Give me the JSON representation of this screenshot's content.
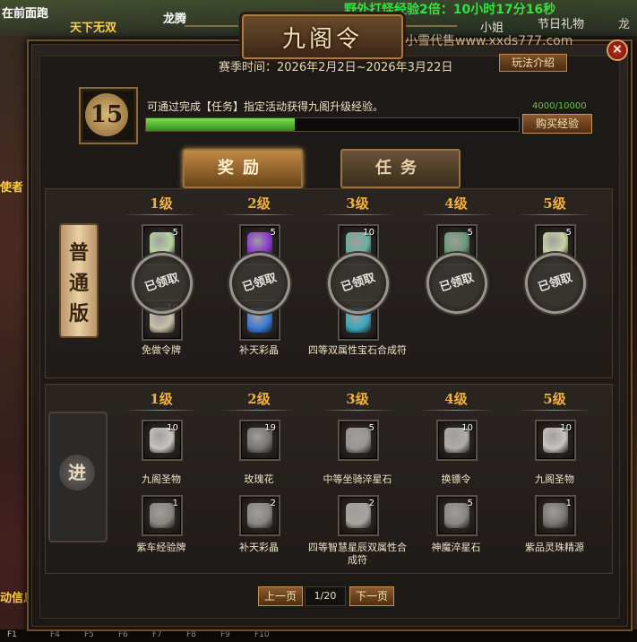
{
  "hud": {
    "left_top": "在前面跑",
    "left_tag": "天下无双",
    "left_name": "龙腾",
    "event_timer": "野外打怪经验2倍：10小时17分16秒",
    "npc_name": "小姐",
    "festival": "节日礼物",
    "right_name": "龙",
    "left_mid": "使者",
    "left_bottom": "动信息",
    "keys": [
      "F1",
      "F4",
      "F5",
      "F6",
      "F7",
      "F8",
      "F9",
      "F10"
    ]
  },
  "panel": {
    "title": "九阁令",
    "watermark": "小雪代售www.xxds777.com",
    "close_label": "×",
    "season_label": "赛季时间：2026年2月2日~2026年3月22日",
    "rules_button": "玩法介绍",
    "current_level": "15",
    "hint": "可通过完成【任务】指定活动获得九阁升级经验。",
    "exp_text": "4000/10000",
    "exp_progress": 0.4,
    "buy_button": "购买经验",
    "tabs": [
      {
        "label": "奖励",
        "active": true
      },
      {
        "label": "任务",
        "active": false
      }
    ]
  },
  "normal": {
    "badge": "普通版",
    "claimed_label": "已领取",
    "levels": [
      {
        "level": "1级",
        "top_count": "5",
        "top_color": "#b8d4a0",
        "bottom_count": "10",
        "bottom_color": "#c8c0a8",
        "name": "免做令牌",
        "claimed": true
      },
      {
        "level": "2级",
        "top_count": "5",
        "top_color": "#8a3ad0",
        "bottom_count": "",
        "bottom_color": "#3a7ad8",
        "name": "补天彩晶",
        "claimed": true
      },
      {
        "level": "3级",
        "top_count": "10",
        "top_color": "#6ab0a0",
        "bottom_count": "",
        "bottom_color": "#3aa8c0",
        "name": "四等双属性宝石合成符",
        "claimed": true
      },
      {
        "level": "4级",
        "top_count": "5",
        "top_color": "#6a9a7a",
        "bottom_count": "",
        "bottom_color": "",
        "name": "",
        "claimed": true
      },
      {
        "level": "5级",
        "top_count": "5",
        "top_color": "#c8d4a0",
        "bottom_count": "",
        "bottom_color": "",
        "name": "",
        "claimed": true
      }
    ]
  },
  "advanced": {
    "badge": "进",
    "levels": [
      {
        "level": "1级",
        "top_count": "10",
        "top_color": "#c8c4be",
        "top_name": "九阁圣物",
        "bottom_count": "1",
        "bottom_color": "#8a8680",
        "bottom_name": "紫车经验牌"
      },
      {
        "level": "2级",
        "top_count": "19",
        "top_color": "#7a7672",
        "top_name": "玫瑰花",
        "bottom_count": "2",
        "bottom_color": "#8a8684",
        "bottom_name": "补天彩晶"
      },
      {
        "level": "3级",
        "top_count": "5",
        "top_color": "#9a9690",
        "top_name": "中等坐骑淬星石",
        "bottom_count": "2",
        "bottom_color": "#a8a49e",
        "bottom_name": "四等智慧星辰双属性合成符"
      },
      {
        "level": "4级",
        "top_count": "10",
        "top_color": "#b0aca6",
        "top_name": "换镖令",
        "bottom_count": "5",
        "bottom_color": "#8a8682",
        "bottom_name": "神魔淬星石"
      },
      {
        "level": "5级",
        "top_count": "10",
        "top_color": "#c8c4be",
        "top_name": "九阁圣物",
        "bottom_count": "1",
        "bottom_color": "#7a7672",
        "bottom_name": "紫品灵珠精源"
      }
    ]
  },
  "pager": {
    "prev": "上一页",
    "page": "1/20",
    "next": "下一页"
  }
}
